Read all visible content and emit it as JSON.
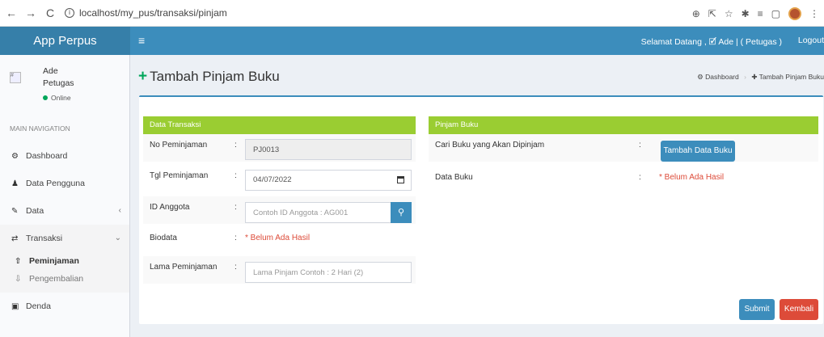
{
  "browser": {
    "url": "localhost/my_pus/transaksi/pinjam",
    "nav": {
      "back": "←",
      "forward": "→",
      "reload": "C"
    },
    "icons": [
      "zoom-icon",
      "share-icon",
      "star-icon",
      "extension-icon",
      "reading-list-icon",
      "sidebar-icon",
      "profile-icon",
      "menu-icon"
    ]
  },
  "header": {
    "logo": "App Perpus",
    "burger": "≡",
    "welcome": "Selamat Datang , 🗹 Ade | ( Petugas )",
    "logout": "Logout"
  },
  "sidebar": {
    "user": {
      "img_alt": "#",
      "name": "Ade",
      "role": "Petugas",
      "status": "Online"
    },
    "nav_header": "MAIN NAVIGATION",
    "items": [
      {
        "label": "Dashboard",
        "icon": "dashboard-icon"
      },
      {
        "label": "Data Pengguna",
        "icon": "user-icon"
      },
      {
        "label": "Data",
        "icon": "edit-icon"
      },
      {
        "label": "Transaksi",
        "icon": "exchange-icon"
      }
    ],
    "submenu": [
      {
        "label": "Peminjaman",
        "icon": "upload-icon"
      },
      {
        "label": "Pengembalian",
        "icon": "download-icon"
      }
    ],
    "denda": {
      "label": "Denda",
      "icon": "money-icon"
    }
  },
  "page": {
    "title": "Tambah Pinjam Buku",
    "breadcrumb": {
      "home": "Dashboard",
      "current": "Tambah Pinjam Buku"
    }
  },
  "transaksi": {
    "heading": "Data Transaksi",
    "no_peminjaman": {
      "label": "No Peminjaman",
      "value": "PJ0013"
    },
    "tgl_peminjaman": {
      "label": "Tgl Peminjaman",
      "value": "04/07/2022"
    },
    "id_anggota": {
      "label": "ID Anggota",
      "placeholder": "Contoh ID Anggota : AG001"
    },
    "biodata": {
      "label": "Biodata",
      "value": "* Belum Ada Hasil"
    },
    "lama": {
      "label": "Lama Peminjaman",
      "placeholder": "Lama Pinjam Contoh : 2 Hari (2)"
    }
  },
  "pinjam": {
    "heading": "Pinjam Buku",
    "cari": {
      "label": "Cari Buku yang Akan Dipinjam",
      "button": "Tambah Data Buku"
    },
    "data_buku": {
      "label": "Data Buku",
      "value": "* Belum Ada Hasil"
    }
  },
  "actions": {
    "submit": "Submit",
    "back": "Kembali"
  },
  "colon": ":"
}
